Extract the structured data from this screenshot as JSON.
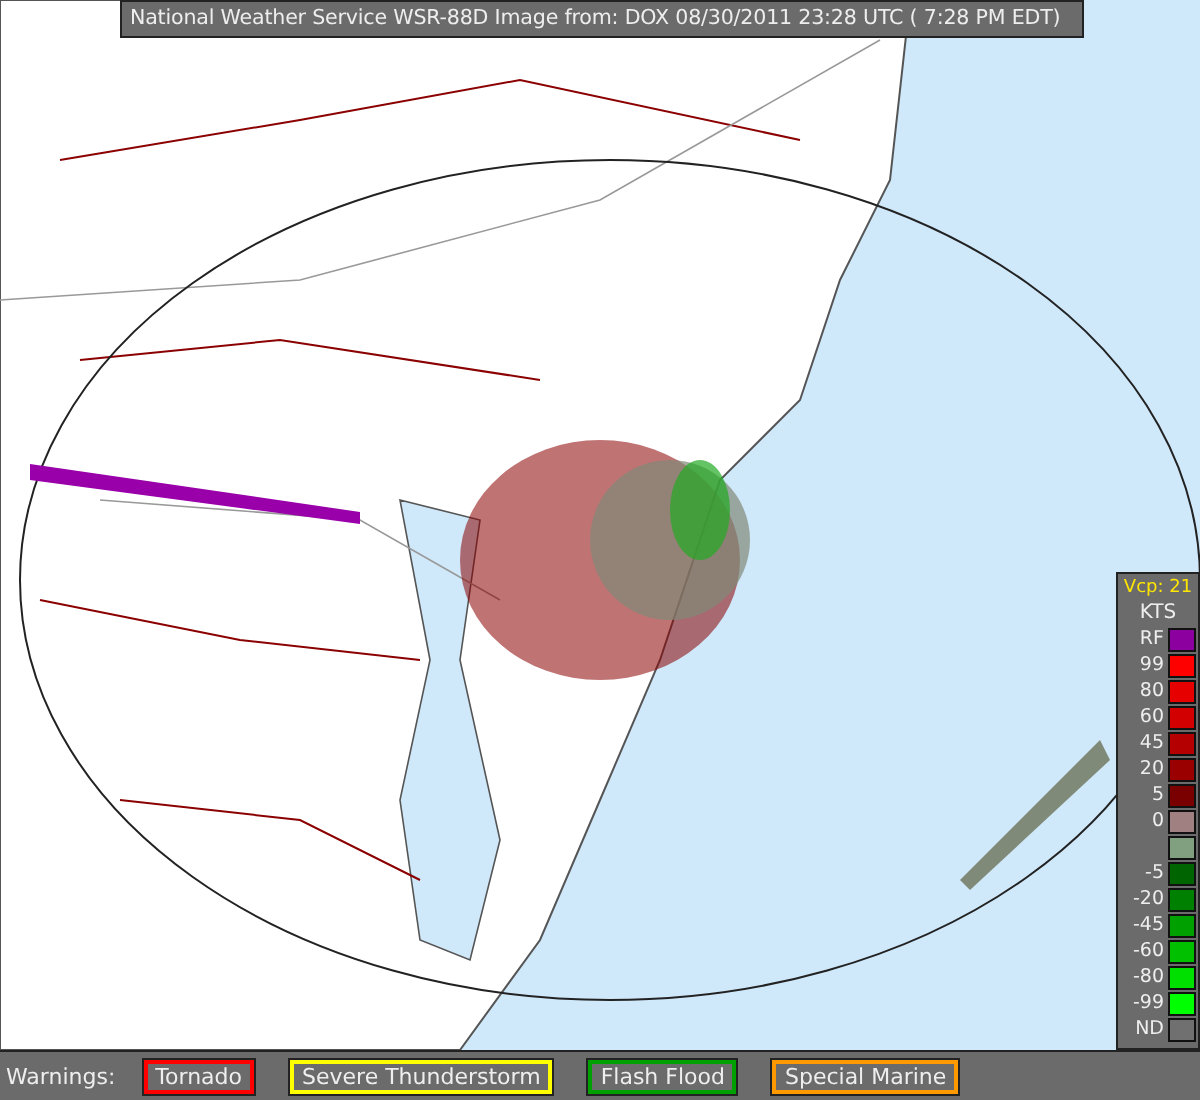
{
  "header": {
    "title": "National Weather Service WSR-88D Image from: DOX 08/30/2011 23:28 UTC ( 7:28 PM EDT)"
  },
  "legend": {
    "mode": "Vcp: 21",
    "units": "KTS",
    "entries": [
      {
        "label": "RF",
        "color": "#8c00a0"
      },
      {
        "label": "99",
        "color": "#ff0000"
      },
      {
        "label": "80",
        "color": "#e60000"
      },
      {
        "label": "60",
        "color": "#d20000"
      },
      {
        "label": "45",
        "color": "#b40000"
      },
      {
        "label": "20",
        "color": "#9a0000"
      },
      {
        "label": "5",
        "color": "#7a0000"
      },
      {
        "label": "0",
        "color": "#a08080"
      },
      {
        "color": "#80a080"
      },
      {
        "label": "-5",
        "color": "#006400"
      },
      {
        "label": "-20",
        "color": "#008000"
      },
      {
        "label": "-45",
        "color": "#00a000"
      },
      {
        "label": "-60",
        "color": "#00c000"
      },
      {
        "label": "-80",
        "color": "#00e000"
      },
      {
        "label": "-99",
        "color": "#00ff00"
      },
      {
        "label": "ND",
        "color": "#707070"
      }
    ]
  },
  "warnings": {
    "label": "Warnings:",
    "items": [
      {
        "label": "Tornado",
        "color": "#ff0000"
      },
      {
        "label": "Severe Thunderstorm",
        "color": "#ffff00"
      },
      {
        "label": "Flash Flood",
        "color": "#00a000"
      },
      {
        "label": "Special Marine",
        "color": "#ff9900"
      }
    ]
  }
}
